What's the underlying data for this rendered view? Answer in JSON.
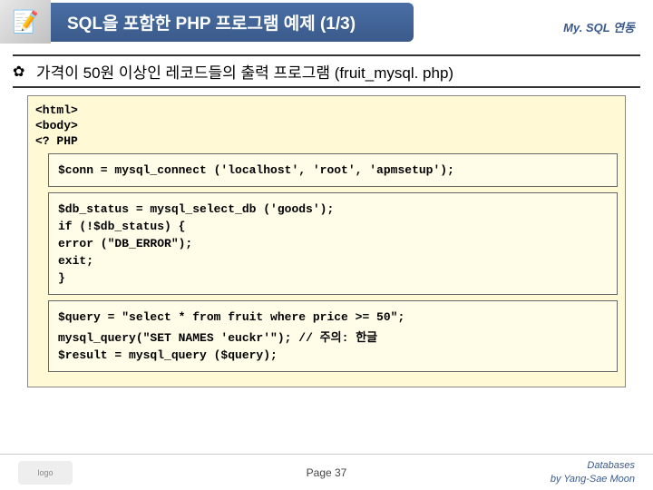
{
  "header": {
    "title": "SQL을 포함한 PHP 프로그램 예제 (1/3)",
    "corner": "My. SQL 연동"
  },
  "subtitle": "가격이 50원 이상인 레코드들의 출력 프로그램 (fruit_mysql. php)",
  "code": {
    "l1": "<html>",
    "l2": "<body>",
    "l3": "<? PHP",
    "block1": {
      "l1": "$conn = mysql_connect ('localhost', 'root', 'apmsetup');"
    },
    "block2": {
      "l1": "$db_status = mysql_select_db ('goods');",
      "l2": "if (!$db_status) {",
      "l3": "error (\"DB_ERROR\");",
      "l4": "exit;",
      "l5": "}"
    },
    "block3": {
      "l1": "$query = \"select * from fruit where price >= 50\";",
      "l2a": "mysql_query(\"SET NAMES 'euckr'\");",
      "l2b": "// 주의: 한글",
      "l3": "$result = mysql_query ($query);"
    }
  },
  "footer": {
    "page": "Page 37",
    "r1": "Databases",
    "r2": "by Yang-Sae Moon"
  }
}
